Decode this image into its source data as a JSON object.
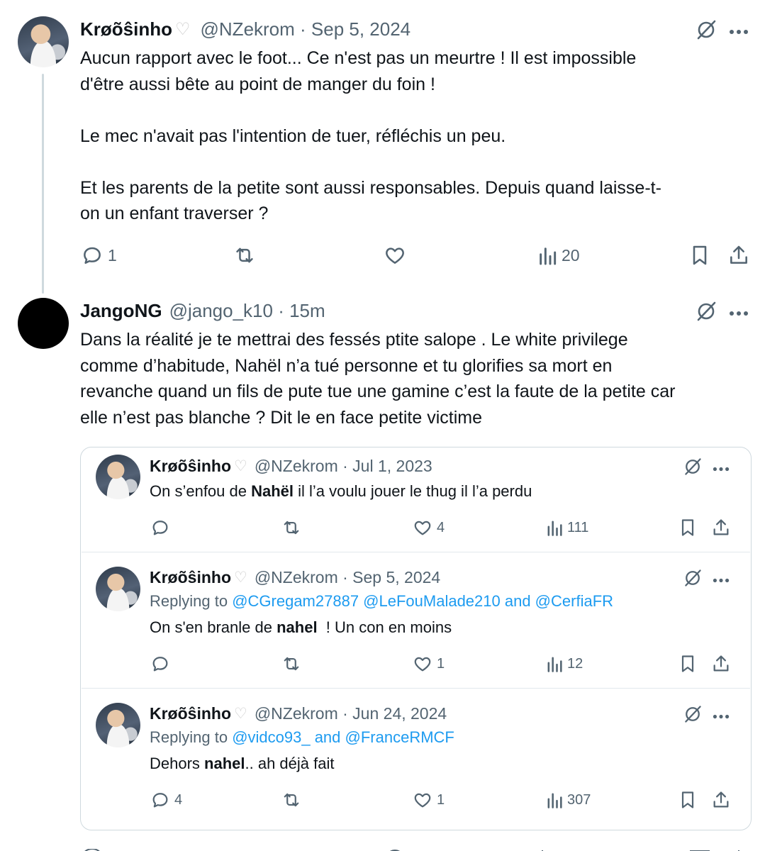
{
  "tweet1": {
    "name": "Krøõŝinho",
    "heart": "♡",
    "handle_meta": "@NZekrom · Sep 5, 2024",
    "lines": [
      "Aucun rapport avec le foot... Ce n'est pas un meurtre ! Il est impossible",
      "d'être aussi bête au point de manger du foin !",
      "",
      "Le mec n'avait pas l'intention de tuer, réfléchis un peu.",
      "",
      "Et les parents de la petite sont aussi responsables. Depuis quand laisse-t-",
      "on un enfant traverser ?"
    ],
    "reply_count": "1",
    "retweet_count": "",
    "like_count": "",
    "view_count": "20"
  },
  "tweet2": {
    "name": "JangoNG",
    "handle_meta": "@jango_k10 · 15m",
    "lines": [
      "Dans la réalité je te mettrai des fessés ptite salope . Le white privilege",
      "comme d’habitude, Nahël n’a tué personne et tu glorifies sa mort en",
      "revanche quand un fils de pute tue une gamine c’est la faute de la petite car",
      "elle n’est pas blanche ? Dit le en face petite victime"
    ]
  },
  "quoted": [
    {
      "name": "Krøõŝinho",
      "heart": "♡",
      "handle_meta": "@NZekrom · Jul 1, 2023",
      "replying_prefix": "",
      "replying_mentions": "",
      "text_before": "On s’enfou de ",
      "text_bold": "Nahël",
      "text_after": " il l’a voulu jouer le thug il l’a perdu",
      "reply_count": "",
      "like_count": "4",
      "view_count": "111"
    },
    {
      "name": "Krøõŝinho",
      "heart": "♡",
      "handle_meta": "@NZekrom · Sep 5, 2024",
      "replying_prefix": "Replying to ",
      "replying_mentions": "@CGregam27887 @LeFouMalade210 and @CerfiaFR",
      "text_before": "On s'en branle de ",
      "text_bold": "nahel",
      "text_after": "  ! Un con en moins",
      "reply_count": "",
      "like_count": "1",
      "view_count": "12"
    },
    {
      "name": "Krøõŝinho",
      "heart": "♡",
      "handle_meta": "@NZekrom · Jun 24, 2024",
      "replying_prefix": "Replying to ",
      "replying_mentions": "@vidco93_ and @FranceRMCF",
      "text_before": "Dehors ",
      "text_bold": "nahel",
      "text_after": ".. ah déjà fait",
      "reply_count": "4",
      "like_count": "1",
      "view_count": "307"
    }
  ],
  "icons": {
    "reply": "reply-bubble-icon",
    "retweet": "retweet-icon",
    "like": "heart-icon",
    "views": "bar-chart-icon",
    "bookmark": "bookmark-icon",
    "share": "share-icon",
    "grok": "grok-slash-icon",
    "more": "more-dots-icon"
  },
  "colors": {
    "text": "#0f1419",
    "secondary": "#536471",
    "link": "#1d9bf0",
    "border": "#cfd9de"
  }
}
